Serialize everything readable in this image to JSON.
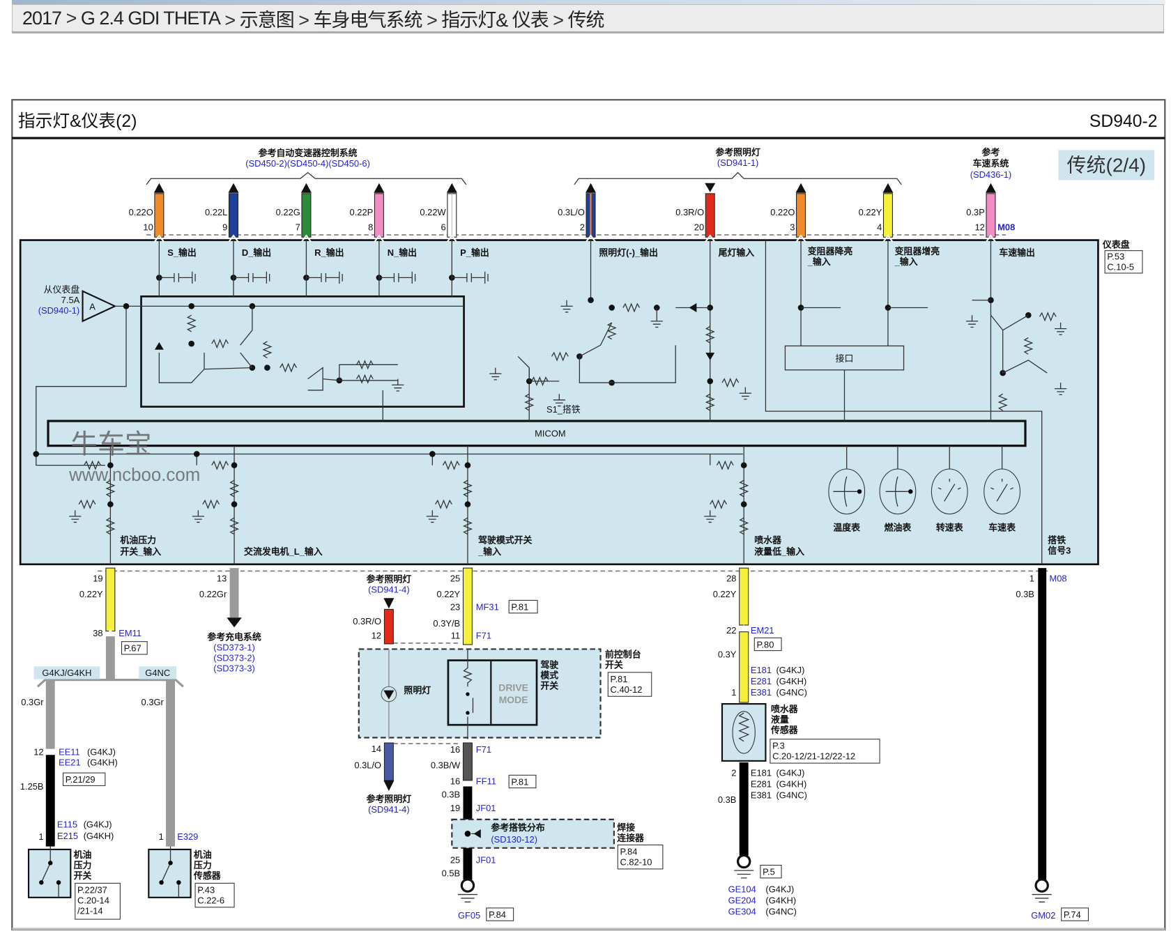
{
  "breadcrumb": [
    "2017",
    "G 2.4 GDI THETA",
    "示意图",
    "车身电气系统",
    "指示灯& 仪表",
    "传统"
  ],
  "diagram": {
    "title": "指示灯&仪表(2)",
    "code": "SD940-2",
    "badge": "传统(2/4)",
    "colors": {
      "panel": "#cfe6ef",
      "link": "#2424c8"
    },
    "refs": {
      "atc": {
        "title": "参考自动变速器控制系统",
        "codes": "(SD450-2)(SD450-4)(SD450-6)"
      },
      "lighting": {
        "title": "参考照明灯",
        "code": "(SD941-1)"
      },
      "speed": {
        "title1": "参考",
        "title2": "车速系统",
        "code": "(SD436-1)"
      }
    },
    "top_wires": [
      {
        "size": "0.22O",
        "pin": "10",
        "label": "S_输出",
        "color": "#f08a2a"
      },
      {
        "size": "0.22L",
        "pin": "9",
        "label": "D_输出",
        "color": "#1f3f9a"
      },
      {
        "size": "0.22G",
        "pin": "7",
        "label": "R_输出",
        "color": "#2e8b3a"
      },
      {
        "size": "0.22P",
        "pin": "8",
        "label": "N_输出",
        "color": "#ee8ec2"
      },
      {
        "size": "0.22W",
        "pin": "6",
        "label": "P_输出",
        "color": "#ffffff"
      },
      {
        "size": "0.3L/O",
        "pin": "2",
        "label": "照明灯(-)_输出",
        "color": "#1f3f9a"
      },
      {
        "size": "0.3R/O",
        "pin": "20",
        "label": "尾灯输入",
        "color": "#e02a1a"
      },
      {
        "size": "0.22O",
        "pin": "3",
        "label1": "变阻器降亮",
        "label2": "_输入",
        "color": "#f08a2a"
      },
      {
        "size": "0.22Y",
        "pin": "4",
        "label1": "变阻器增亮",
        "label2": "_输入",
        "color": "#f5f03a"
      },
      {
        "size": "0.3P",
        "pin": "12",
        "label": "车速输出",
        "color": "#ee8ec2",
        "connector": "M08"
      }
    ],
    "cluster": {
      "name": "仪表盘",
      "page": "P.53",
      "conn": "C.10-5",
      "from1": "从仪表盘",
      "fuse": "7.5A",
      "from_code": "(SD940-1)",
      "amp": "A",
      "micom": "MICOM",
      "interface": "接口",
      "ground": "S1_搭铁",
      "gauges": [
        "温度表",
        "燃油表",
        "转速表",
        "车速表"
      ],
      "inputs": {
        "oil1": "机油压力",
        "oil2": "开关_输入",
        "alt": "交流发电机_L_输入",
        "drive1": "驾驶模式开关",
        "drive2": "_输入",
        "washer1": "喷水器",
        "washer2": "液量低_输入",
        "gnd1": "搭铁",
        "gnd2": "信号3"
      },
      "watermark": "牛车宝",
      "watermark_url": "www.ncboo.com"
    },
    "oil": {
      "pin": "19",
      "size": "0.22Y",
      "conn_pin": "38",
      "conn": "EM11",
      "page": "P.67",
      "branch_a": "G4KJ/G4KH",
      "branch_b": "G4NC",
      "left": {
        "size": "0.3Gr",
        "pin": "12",
        "conn1": "EE11",
        "var1": "(G4KJ)",
        "conn2": "EE21",
        "var2": "(G4KH)",
        "page": "P.21/29",
        "size2": "1.25B",
        "end_pin": "1",
        "end1": "E115",
        "evar1": "(G4KJ)",
        "end2": "E215",
        "evar2": "(G4KH)",
        "dev1": "机油",
        "dev2": "压力",
        "dev3": "开关",
        "p1": "P.22/37",
        "p2": "C.20-14",
        "p3": "/21-14"
      },
      "right": {
        "size": "0.3Gr",
        "end_pin": "1",
        "end": "E329",
        "dev1": "机油",
        "dev2": "压力",
        "dev3": "传感器",
        "p1": "P.43",
        "p2": "C.22-6"
      }
    },
    "alt": {
      "pin": "13",
      "size": "0.22Gr",
      "ref": "参考充电系统",
      "codes": [
        "(SD373-1)",
        "(SD373-2)",
        "(SD373-3)"
      ]
    },
    "lamp": {
      "ref": "参考照明灯",
      "ref_code": "(SD941-4)",
      "size": "0.3R/O",
      "pin": "12",
      "label": "照明灯",
      "pin2": "14",
      "size2": "0.3L/O",
      "ref2": "参考照明灯",
      "ref2_code": "(SD941-4)"
    },
    "drive": {
      "pin": "25",
      "size": "0.22Y",
      "pin2": "23",
      "conn2": "MF31",
      "page2": "P.81",
      "size2": "0.3Y/B",
      "pin3": "11",
      "conn3": "F71",
      "logo1": "DRIVE",
      "logo2": "MODE",
      "sw1": "驾驶",
      "sw2": "模式",
      "sw3": "开关",
      "dev1": "前控制台",
      "dev2": "开关",
      "dev_p1": "P.81",
      "dev_p2": "C.40-12",
      "pin4": "16",
      "conn4": "F71",
      "size4": "0.3B/W",
      "pin5": "16",
      "conn5": "FF11",
      "page5": "P.81",
      "size6": "0.3B",
      "pin6": "19",
      "conn6": "JF01",
      "gref": "参考搭铁分布",
      "gref_code": "(SD130-12)",
      "joint1": "焊接",
      "joint2": "连接器",
      "jp1": "P.84",
      "jp2": "C.82-10",
      "pin7": "25",
      "conn7": "JF01",
      "size7": "0.5B",
      "gnd": "GF05",
      "gnd_page": "P.84"
    },
    "washer": {
      "pin": "28",
      "size": "0.22Y",
      "pin2": "22",
      "conn2": "EM21",
      "page2": "P.80",
      "size2": "0.3Y",
      "pin3": "1",
      "c1": "E181",
      "v1": "(G4KJ)",
      "c2": "E281",
      "v2": "(G4KH)",
      "c3": "E381",
      "v3": "(G4NC)",
      "dev1": "喷水器",
      "dev2": "液量",
      "dev3": "传感器",
      "p1": "P.3",
      "p2": "C.20-12/21-12/22-12",
      "pin4": "2",
      "size4": "0.3B",
      "gnd_page": "P.5",
      "g1": "GE104",
      "gv1": "(G4KJ)",
      "g2": "GE204",
      "gv2": "(G4KH)",
      "g3": "GE304",
      "gv3": "(G4NC)"
    },
    "gndsig": {
      "pin": "1",
      "conn": "M08",
      "size": "0.3B",
      "gnd": "GM02",
      "gnd_page": "P.74"
    }
  }
}
